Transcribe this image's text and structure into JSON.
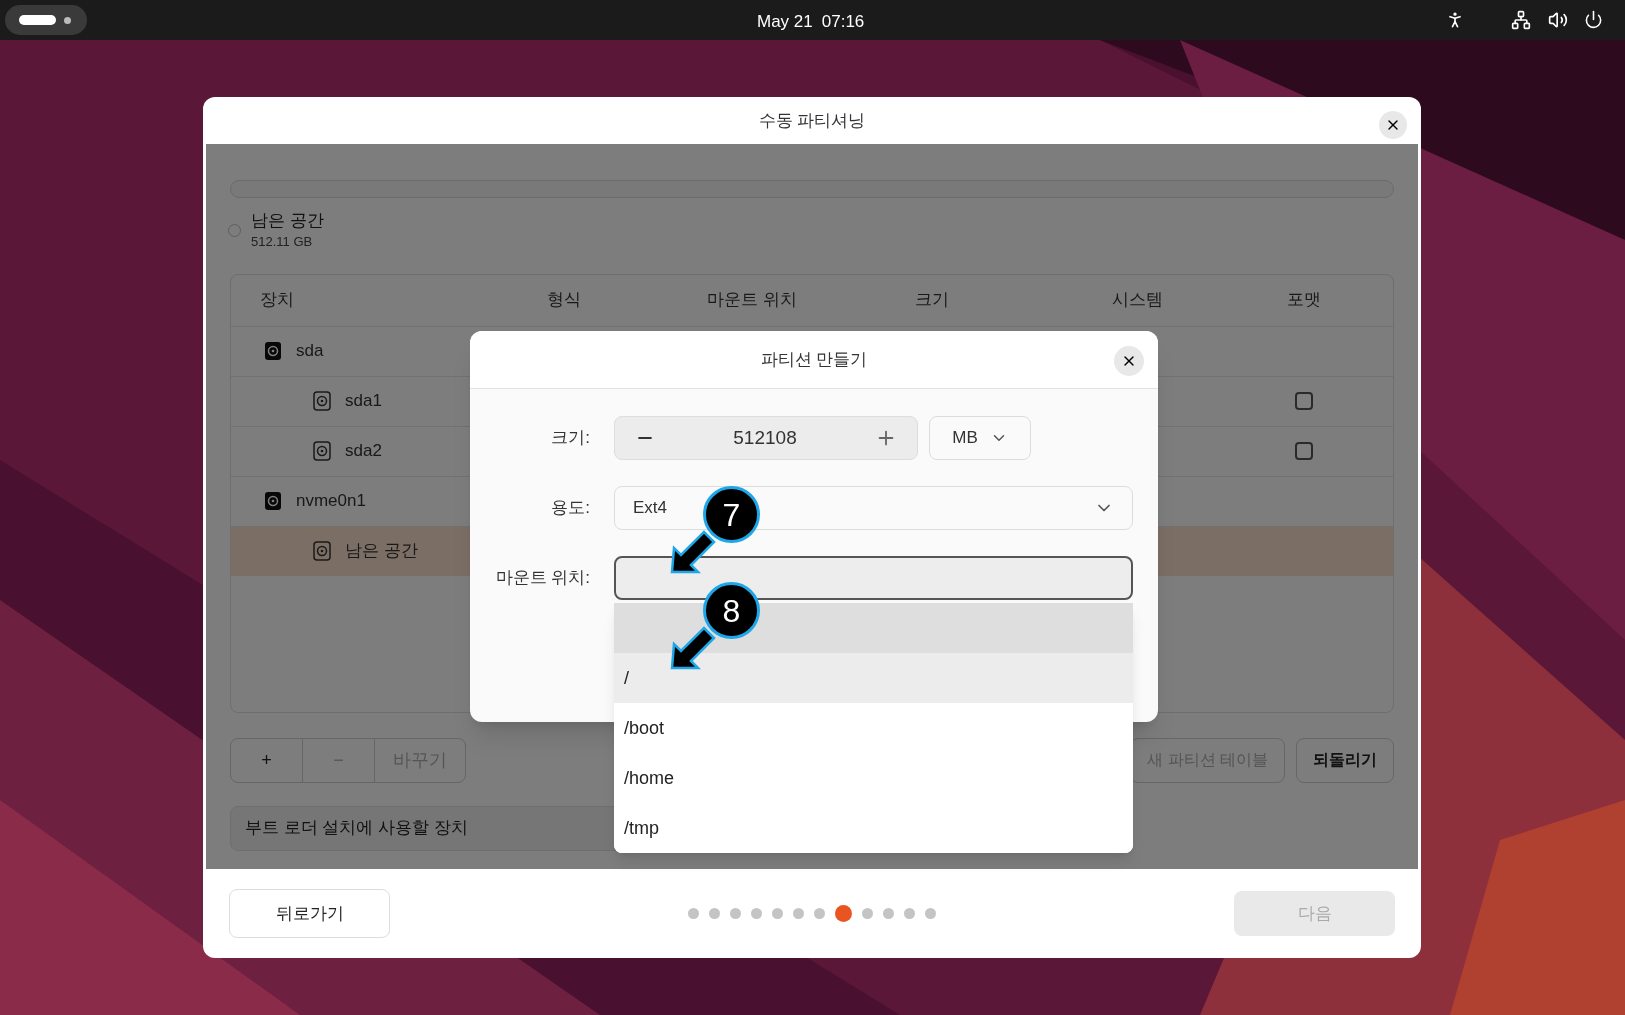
{
  "top_bar": {
    "date": "May 21",
    "time": "07:16"
  },
  "dialog": {
    "title": "수동 파티셔닝",
    "free_space": {
      "label": "남은 공간",
      "size": "512.11 GB",
      "selected": false
    },
    "table": {
      "columns": [
        "장치",
        "형식",
        "마운트 위치",
        "크기",
        "시스템",
        "포맷"
      ],
      "rows": [
        {
          "device": "sda",
          "selected": false,
          "children": [
            {
              "device": "sda1",
              "format": false,
              "selected": false
            },
            {
              "device": "sda2",
              "format": false,
              "selected": false
            }
          ]
        },
        {
          "device": "nvme0n1",
          "selected": false,
          "children": [
            {
              "device": "남은 공간",
              "selected": true
            }
          ]
        }
      ]
    },
    "toolbar_left": [
      {
        "label": "+",
        "disabled": false
      },
      {
        "label": "−",
        "disabled": true
      },
      {
        "label": "바꾸기",
        "disabled": true
      }
    ],
    "toolbar_right": [
      {
        "label": "새 파티션 테이블",
        "disabled": true
      },
      {
        "label": "되돌리기",
        "disabled": false
      }
    ],
    "bootloader": {
      "label": "부트 로더 설치에 사용할 장치"
    },
    "footer": {
      "back": "뒤로가기",
      "next": {
        "label": "다음",
        "disabled": true
      },
      "pages": [
        {
          "selected": false
        },
        {
          "selected": false
        },
        {
          "selected": false
        },
        {
          "selected": false
        },
        {
          "selected": false
        },
        {
          "selected": false
        },
        {
          "selected": false
        },
        {
          "selected": true
        },
        {
          "selected": false
        },
        {
          "selected": false
        },
        {
          "selected": false
        },
        {
          "selected": false
        }
      ]
    }
  },
  "modal": {
    "title": "파티션 만들기",
    "size": {
      "label": "크기:",
      "value": "512108",
      "unit": "MB"
    },
    "usage": {
      "label": "용도:",
      "value": "Ext4"
    },
    "mount": {
      "label": "마운트 위치:"
    },
    "options": [
      {
        "selected": true,
        "hovered": false
      },
      {
        "label": "/",
        "selected": false,
        "hovered": true
      },
      {
        "label": "/boot",
        "selected": false,
        "hovered": false
      },
      {
        "label": "/home",
        "selected": false,
        "hovered": false
      },
      {
        "label": "/tmp",
        "selected": false,
        "hovered": false
      }
    ]
  },
  "callouts": [
    {
      "number": "7"
    },
    {
      "number": "8"
    }
  ]
}
